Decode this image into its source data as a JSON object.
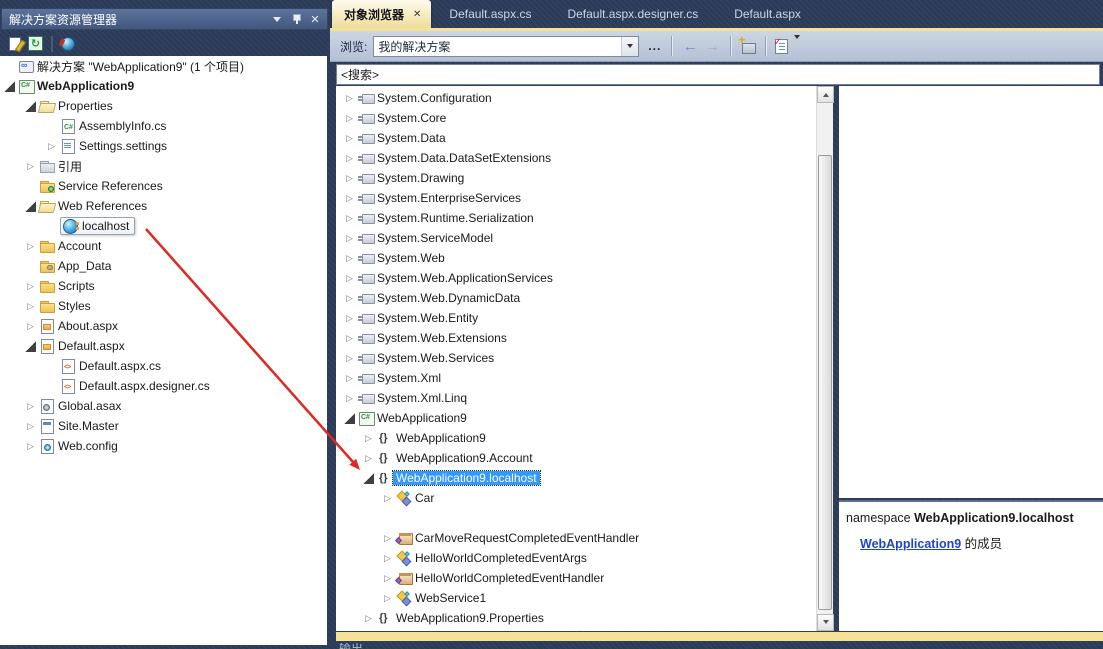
{
  "colors": {
    "accent_cream": "#f7e197",
    "selection_blue": "#3399ff",
    "arrow_red": "#dc2a20",
    "link_blue": "#2143c8",
    "titlebar_blue": "#4c6187"
  },
  "solution_explorer": {
    "title": "解决方案资源管理器",
    "items": [
      {
        "label": "解决方案 \"WebApplication9\" (1 个项目)",
        "level": 0,
        "expand": null,
        "icon": "solution"
      },
      {
        "label": "WebApplication9",
        "level": 0,
        "expand": "open",
        "icon": "project",
        "bold": true
      },
      {
        "label": "Properties",
        "level": 1,
        "expand": "open",
        "icon": "folder-open"
      },
      {
        "label": "AssemblyInfo.cs",
        "level": 2,
        "expand": null,
        "icon": "cs"
      },
      {
        "label": "Settings.settings",
        "level": 2,
        "expand": "closed",
        "icon": "settings"
      },
      {
        "label": "引用",
        "level": 1,
        "expand": "closed",
        "icon": "folder-ref"
      },
      {
        "label": "Service References",
        "level": 1,
        "expand": null,
        "icon": "folder-svc"
      },
      {
        "label": "Web References",
        "level": 1,
        "expand": "open",
        "icon": "folder-open"
      },
      {
        "label": "localhost",
        "level": 2,
        "expand": null,
        "icon": "globe",
        "boxed": true
      },
      {
        "label": "Account",
        "level": 1,
        "expand": "closed",
        "icon": "folder"
      },
      {
        "label": "App_Data",
        "level": 1,
        "expand": null,
        "icon": "folder-data"
      },
      {
        "label": "Scripts",
        "level": 1,
        "expand": "closed",
        "icon": "folder"
      },
      {
        "label": "Styles",
        "level": 1,
        "expand": "closed",
        "icon": "folder"
      },
      {
        "label": "About.aspx",
        "level": 1,
        "expand": "closed",
        "icon": "aspx"
      },
      {
        "label": "Default.aspx",
        "level": 1,
        "expand": "open",
        "icon": "aspx"
      },
      {
        "label": "Default.aspx.cs",
        "level": 2,
        "expand": null,
        "icon": "csfile"
      },
      {
        "label": "Default.aspx.designer.cs",
        "level": 2,
        "expand": null,
        "icon": "csfile"
      },
      {
        "label": "Global.asax",
        "level": 1,
        "expand": "closed",
        "icon": "asax"
      },
      {
        "label": "Site.Master",
        "level": 1,
        "expand": "closed",
        "icon": "master"
      },
      {
        "label": "Web.config",
        "level": 1,
        "expand": "closed",
        "icon": "config"
      }
    ]
  },
  "tabs": [
    {
      "id": "object-browser",
      "label": "对象浏览器",
      "active": true,
      "closable": true
    },
    {
      "id": "default-aspx-cs",
      "label": "Default.aspx.cs",
      "active": false
    },
    {
      "id": "default-aspx-designer-cs",
      "label": "Default.aspx.designer.cs",
      "active": false
    },
    {
      "id": "default-aspx",
      "label": "Default.aspx",
      "active": false
    }
  ],
  "object_browser": {
    "browse_label": "浏览:",
    "browse_value": "我的解决方案",
    "ellipsis_label": "...",
    "search_placeholder": "<搜索>",
    "items": [
      {
        "label": "System.Configuration",
        "level": 0,
        "expand": "closed",
        "icon": "asm"
      },
      {
        "label": "System.Core",
        "level": 0,
        "expand": "closed",
        "icon": "asm"
      },
      {
        "label": "System.Data",
        "level": 0,
        "expand": "closed",
        "icon": "asm"
      },
      {
        "label": "System.Data.DataSetExtensions",
        "level": 0,
        "expand": "closed",
        "icon": "asm"
      },
      {
        "label": "System.Drawing",
        "level": 0,
        "expand": "closed",
        "icon": "asm"
      },
      {
        "label": "System.EnterpriseServices",
        "level": 0,
        "expand": "closed",
        "icon": "asm"
      },
      {
        "label": "System.Runtime.Serialization",
        "level": 0,
        "expand": "closed",
        "icon": "asm"
      },
      {
        "label": "System.ServiceModel",
        "level": 0,
        "expand": "closed",
        "icon": "asm"
      },
      {
        "label": "System.Web",
        "level": 0,
        "expand": "closed",
        "icon": "asm"
      },
      {
        "label": "System.Web.ApplicationServices",
        "level": 0,
        "expand": "closed",
        "icon": "asm"
      },
      {
        "label": "System.Web.DynamicData",
        "level": 0,
        "expand": "closed",
        "icon": "asm"
      },
      {
        "label": "System.Web.Entity",
        "level": 0,
        "expand": "closed",
        "icon": "asm"
      },
      {
        "label": "System.Web.Extensions",
        "level": 0,
        "expand": "closed",
        "icon": "asm"
      },
      {
        "label": "System.Web.Services",
        "level": 0,
        "expand": "closed",
        "icon": "asm"
      },
      {
        "label": "System.Xml",
        "level": 0,
        "expand": "closed",
        "icon": "asm"
      },
      {
        "label": "System.Xml.Linq",
        "level": 0,
        "expand": "closed",
        "icon": "asm"
      },
      {
        "label": "WebApplication9",
        "level": 0,
        "expand": "open",
        "icon": "project"
      },
      {
        "label": "WebApplication9",
        "level": 1,
        "expand": "closed",
        "icon": "ns"
      },
      {
        "label": "WebApplication9.Account",
        "level": 1,
        "expand": "closed",
        "icon": "ns"
      },
      {
        "label": "WebApplication9.localhost",
        "level": 1,
        "expand": "open",
        "icon": "ns",
        "selected": true
      },
      {
        "label": "Car",
        "level": 2,
        "expand": "closed",
        "icon": "class"
      },
      {
        "blank": true
      },
      {
        "label": "CarMoveRequestCompletedEventHandler",
        "level": 2,
        "expand": "closed",
        "icon": "delegate"
      },
      {
        "label": "HelloWorldCompletedEventArgs",
        "level": 2,
        "expand": "closed",
        "icon": "class"
      },
      {
        "label": "HelloWorldCompletedEventHandler",
        "level": 2,
        "expand": "closed",
        "icon": "delegate"
      },
      {
        "label": "WebService1",
        "level": 2,
        "expand": "closed",
        "icon": "class"
      },
      {
        "label": "WebApplication9.Properties",
        "level": 1,
        "expand": "closed",
        "icon": "ns"
      }
    ],
    "description": {
      "keyword": "namespace ",
      "name": "WebApplication9.localhost",
      "link": "WebApplication9",
      "suffix": " 的成员"
    }
  },
  "output_partial": "输出"
}
